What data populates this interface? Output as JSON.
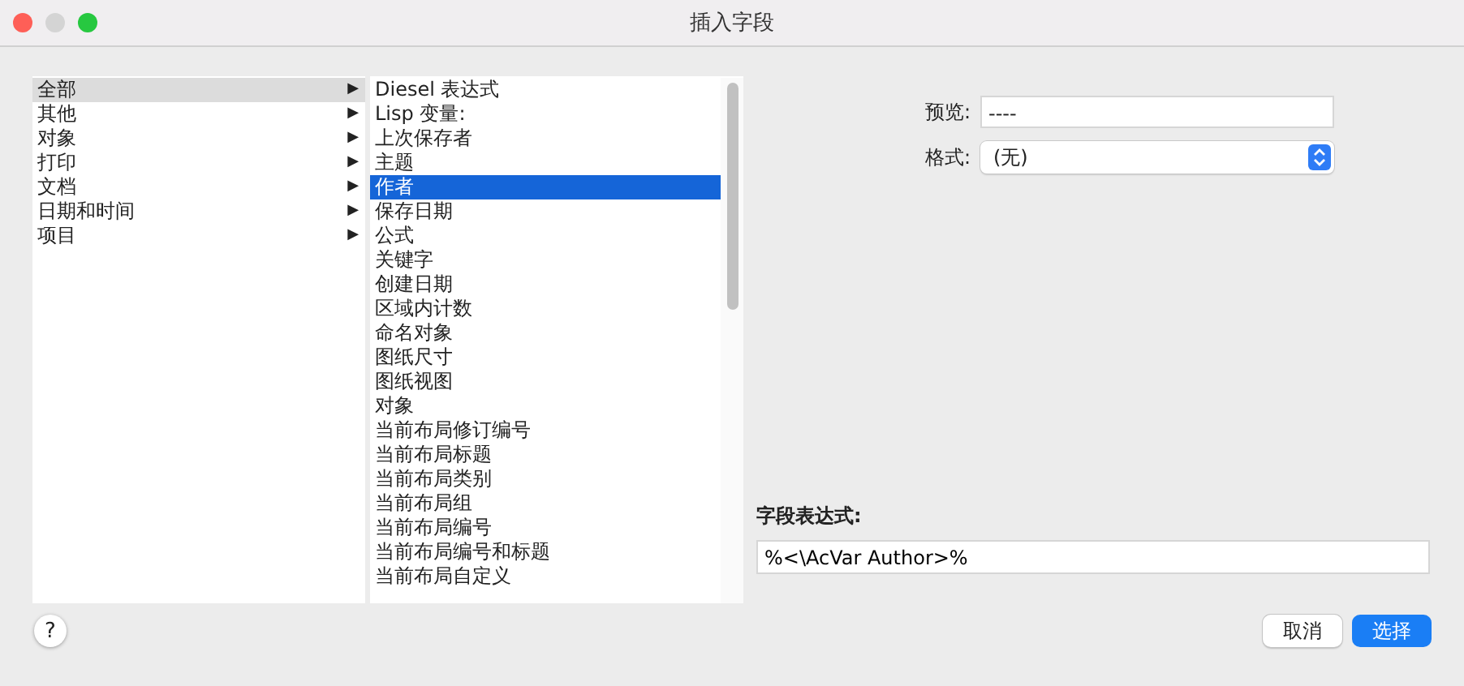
{
  "window": {
    "title": "插入字段"
  },
  "categories": [
    {
      "label": "全部",
      "selected": true,
      "submenu": "▶"
    },
    {
      "label": "其他",
      "selected": false,
      "submenu": "▶"
    },
    {
      "label": "对象",
      "selected": false,
      "submenu": "▶"
    },
    {
      "label": "打印",
      "selected": false,
      "submenu": "▶"
    },
    {
      "label": "文档",
      "selected": false,
      "submenu": "▶"
    },
    {
      "label": "日期和时间",
      "selected": false,
      "submenu": "▶"
    },
    {
      "label": "项目",
      "selected": false,
      "submenu": "▶"
    }
  ],
  "fields": [
    {
      "label": "Diesel 表达式",
      "selected": false
    },
    {
      "label": "Lisp 变量:",
      "selected": false
    },
    {
      "label": "上次保存者",
      "selected": false
    },
    {
      "label": "主题",
      "selected": false
    },
    {
      "label": "作者",
      "selected": true
    },
    {
      "label": "保存日期",
      "selected": false
    },
    {
      "label": "公式",
      "selected": false
    },
    {
      "label": "关键字",
      "selected": false
    },
    {
      "label": "创建日期",
      "selected": false
    },
    {
      "label": "区域内计数",
      "selected": false
    },
    {
      "label": "命名对象",
      "selected": false
    },
    {
      "label": "图纸尺寸",
      "selected": false
    },
    {
      "label": "图纸视图",
      "selected": false
    },
    {
      "label": "对象",
      "selected": false
    },
    {
      "label": "当前布局修订编号",
      "selected": false
    },
    {
      "label": "当前布局标题",
      "selected": false
    },
    {
      "label": "当前布局类别",
      "selected": false
    },
    {
      "label": "当前布局组",
      "selected": false
    },
    {
      "label": "当前布局编号",
      "selected": false
    },
    {
      "label": "当前布局编号和标题",
      "selected": false
    },
    {
      "label": "当前布局自定义",
      "selected": false
    }
  ],
  "preview": {
    "label": "预览:",
    "value": "----"
  },
  "format": {
    "label": "格式:",
    "value": "(无)"
  },
  "expression": {
    "label": "字段表达式:",
    "value": "%<\\AcVar Author>%"
  },
  "help": "?",
  "buttons": [
    {
      "label": "取消",
      "kind": "secondary"
    },
    {
      "label": "选择",
      "kind": "primary"
    }
  ]
}
